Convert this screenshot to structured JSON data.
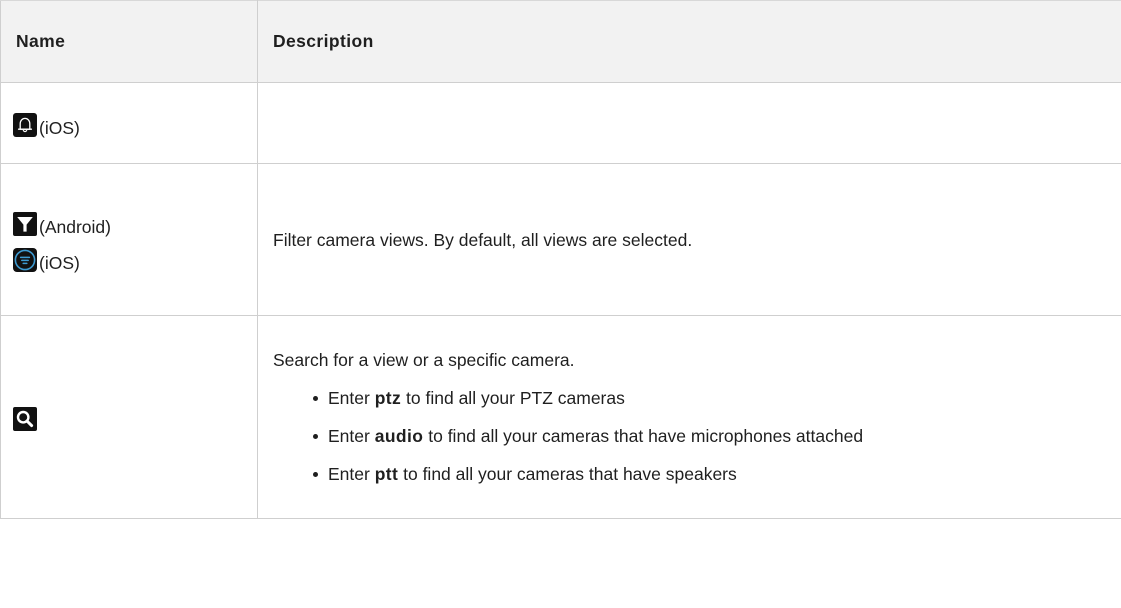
{
  "table": {
    "headers": {
      "name": "Name",
      "description": "Description"
    },
    "rows": {
      "notifications": {
        "name_items": [
          {
            "icon": "bell-icon",
            "platform": "(iOS)"
          }
        ],
        "description": ""
      },
      "filter": {
        "name_items": [
          {
            "icon": "filter-funnel-icon",
            "platform": "(Android)"
          },
          {
            "icon": "filter-lines-icon",
            "platform": "(iOS)"
          }
        ],
        "description": "Filter camera views. By default, all views are selected."
      },
      "search": {
        "name_items": [
          {
            "icon": "search-icon",
            "platform": ""
          }
        ],
        "description": "Search for a view or a specific camera.",
        "bullets": [
          {
            "prefix": "Enter ",
            "keyword": "ptz",
            "suffix": " to find all your PTZ cameras"
          },
          {
            "prefix": "Enter ",
            "keyword": "audio",
            "suffix": " to find all your cameras that have microphones attached"
          },
          {
            "prefix": "Enter ",
            "keyword": "ptt",
            "suffix": " to find all your cameras that have speakers"
          }
        ]
      }
    }
  },
  "colors": {
    "border": "#cfcfcf",
    "header_bg": "#f2f2f2",
    "icon_bg": "#111111",
    "ios_filter_accent": "#3d9ad1"
  }
}
